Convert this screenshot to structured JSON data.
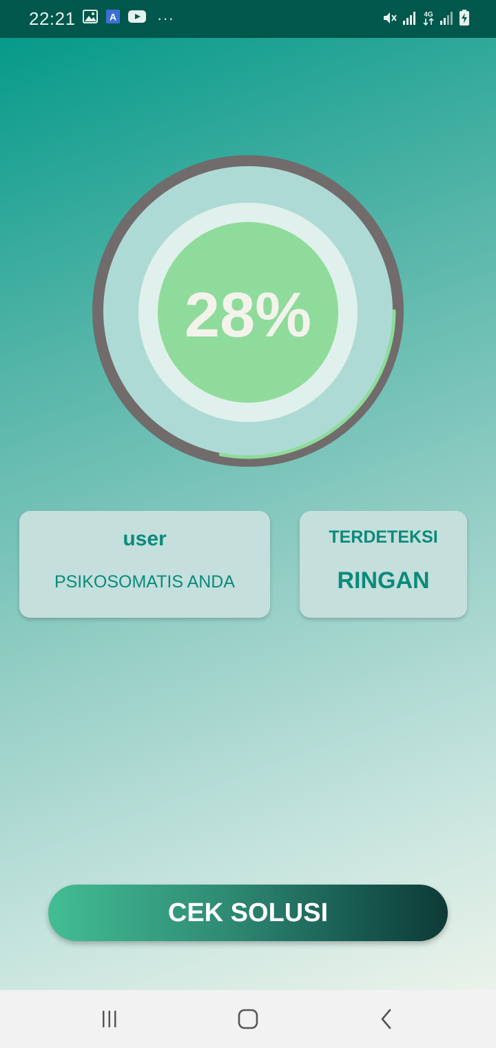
{
  "status_bar": {
    "time": "22:21",
    "left_icons": [
      "image-icon",
      "translate-a-icon",
      "youtube-icon"
    ],
    "overflow": "···",
    "right_icons": [
      "mute-icon",
      "signal-icon",
      "4g-data-icon",
      "signal-2-icon",
      "battery-charging-icon"
    ]
  },
  "gauge": {
    "percent_text": "28%",
    "progress": 0.28
  },
  "user_card": {
    "name": "user",
    "subtitle": "PSIKOSOMATIS ANDA"
  },
  "result_card": {
    "label": "TERDETEKSI",
    "value": "RINGAN"
  },
  "cta": {
    "label": "CEK SOLUSI"
  },
  "nav_bar": {
    "buttons": [
      "recents-icon",
      "home-icon",
      "back-icon"
    ]
  },
  "colors": {
    "status_bar": "#00574b",
    "accent_teal": "#0b8a7a",
    "progress_green": "#8edb9c",
    "ring_track": "#716b6b"
  }
}
